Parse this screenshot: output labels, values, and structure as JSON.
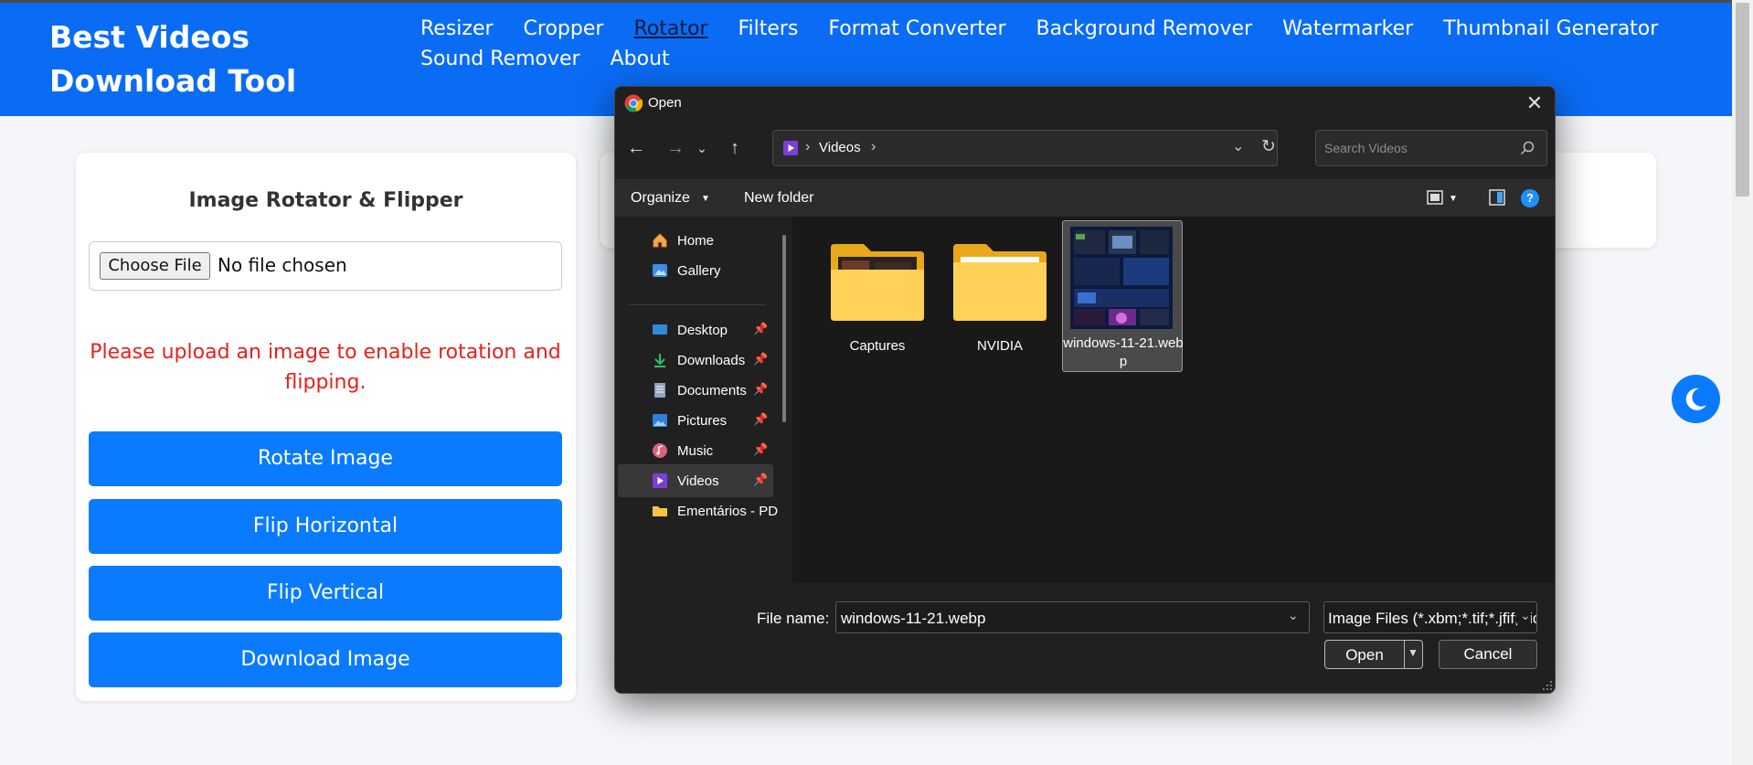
{
  "site": {
    "brand": "Best Videos Download Tool",
    "nav": [
      "Resizer",
      "Cropper",
      "Rotator",
      "Filters",
      "Format Converter",
      "Background Remover",
      "Watermarker",
      "Thumbnail Generator",
      "Sound Remover",
      "About"
    ],
    "active_nav": "Rotator"
  },
  "tool": {
    "title": "Image Rotator & Flipper",
    "choose_file": "Choose File",
    "no_file": "No file chosen",
    "warning": "Please upload an image to enable rotation and flipping.",
    "buttons": {
      "rotate": "Rotate Image",
      "flip_h": "Flip Horizontal",
      "flip_v": "Flip Vertical",
      "download": "Download Image"
    }
  },
  "dialog": {
    "title": "Open",
    "address": {
      "current": "Videos"
    },
    "search_placeholder": "Search Videos",
    "commands": {
      "organize": "Organize",
      "new_folder": "New folder"
    },
    "sidebar": [
      {
        "label": "Home",
        "icon": "home-icon",
        "pinned": false
      },
      {
        "label": "Gallery",
        "icon": "gallery-icon",
        "pinned": false
      },
      {
        "label": "Desktop",
        "icon": "desktop-icon",
        "pinned": true
      },
      {
        "label": "Downloads",
        "icon": "download-icon",
        "pinned": true
      },
      {
        "label": "Documents",
        "icon": "documents-icon",
        "pinned": true
      },
      {
        "label": "Pictures",
        "icon": "pictures-icon",
        "pinned": true
      },
      {
        "label": "Music",
        "icon": "music-icon",
        "pinned": true
      },
      {
        "label": "Videos",
        "icon": "videos-icon",
        "pinned": true,
        "selected": true
      },
      {
        "label": "Ementários - PD",
        "icon": "folder-icon",
        "pinned": false
      }
    ],
    "files": [
      {
        "name": "Captures",
        "type": "folder"
      },
      {
        "name": "NVIDIA",
        "type": "folder"
      },
      {
        "name": "windows-11-21.webp",
        "type": "image",
        "selected": true
      }
    ],
    "file_name_label": "File name:",
    "file_name": "windows-11-21.webp",
    "file_type": "Image Files (*.xbm;*.tif;*.jfif;*.ico;*.tiff;*.gif;*.svg;*.jpeg;*.svgz;*.jpg;*.webp;*.png;*.bmp;*.pjp;*.apng;*.pjpeg;*.avif)",
    "open_label": "Open",
    "cancel_label": "Cancel"
  },
  "colors": {
    "header_bg": "#0a6cf5",
    "primary_button": "#0a7bff",
    "warning_text": "#e8201a",
    "dialog_bg": "#202020"
  }
}
